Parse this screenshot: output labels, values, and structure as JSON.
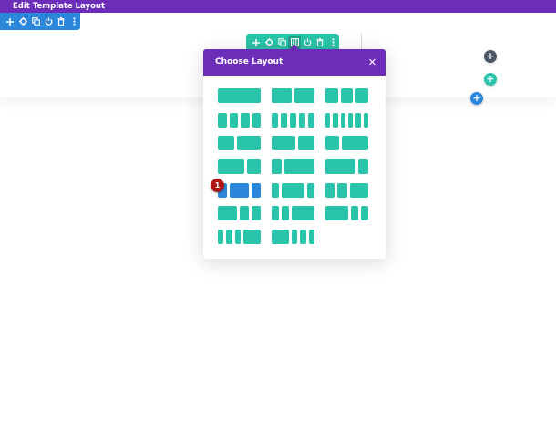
{
  "topbar": {
    "title": "Edit Template Layout"
  },
  "section_toolbar": {
    "icons": [
      "add-icon",
      "settings-icon",
      "duplicate-icon",
      "toggle-icon",
      "delete-icon",
      "more-icon"
    ]
  },
  "row_toolbar": {
    "icons": [
      "add-icon",
      "settings-icon",
      "duplicate-icon",
      "columns-icon",
      "toggle-icon",
      "delete-icon",
      "more-icon"
    ]
  },
  "buttons": {
    "add_module": "+",
    "add_row": "+",
    "add_section": "+"
  },
  "modal": {
    "title": "Choose Layout",
    "close": "✕",
    "layouts": [
      {
        "name": "1",
        "cols": [
          1
        ]
      },
      {
        "name": "1/2 + 1/2",
        "cols": [
          1,
          1
        ]
      },
      {
        "name": "1/3 + 1/3 + 1/3",
        "cols": [
          1,
          1,
          1
        ]
      },
      {
        "name": "1/4 x4",
        "cols": [
          1,
          1,
          1,
          1
        ]
      },
      {
        "name": "1/5 x5",
        "cols": [
          1,
          1,
          1,
          1,
          1
        ]
      },
      {
        "name": "1/6 x6",
        "cols": [
          1,
          1,
          1,
          1,
          1,
          1
        ]
      },
      {
        "name": "2/5 + 3/5",
        "cols": [
          2,
          3
        ]
      },
      {
        "name": "3/5 + 2/5",
        "cols": [
          3,
          2
        ]
      },
      {
        "name": "1/3 + 2/3",
        "cols": [
          1,
          2
        ]
      },
      {
        "name": "2/3 + 1/3",
        "cols": [
          2,
          1
        ]
      },
      {
        "name": "1/4 + 3/4",
        "cols": [
          1,
          3
        ]
      },
      {
        "name": "3/4 + 1/4",
        "cols": [
          3,
          1
        ]
      },
      {
        "name": "1/4 + 1/2 + 1/4",
        "cols": [
          1,
          2,
          1
        ]
      },
      {
        "name": "1/5 + 3/5 + 1/5",
        "cols": [
          1,
          3,
          1
        ]
      },
      {
        "name": "1/4 + 1/4 + 1/2",
        "cols": [
          1,
          1,
          2
        ]
      },
      {
        "name": "1/2 + 1/4 + 1/4",
        "cols": [
          2,
          1,
          1
        ]
      },
      {
        "name": "1/5 + 1/5 + 3/5",
        "cols": [
          1,
          1,
          3
        ]
      },
      {
        "name": "3/5 + 1/5 + 1/5",
        "cols": [
          3,
          1,
          1
        ]
      },
      {
        "name": "1/6 x4 + 1/3",
        "cols": [
          1,
          1,
          1,
          3
        ]
      },
      {
        "name": "1/3 + 1/6 x4",
        "cols": [
          3,
          1,
          1,
          1
        ]
      }
    ],
    "hover_index": 12
  },
  "annotation": {
    "label": "1"
  },
  "colors": {
    "purple": "#6c2eb9",
    "row_teal": "#29c4a9",
    "section_blue": "#2b87da",
    "module_gray": "#4c5866",
    "annotation_red": "#b01515"
  }
}
